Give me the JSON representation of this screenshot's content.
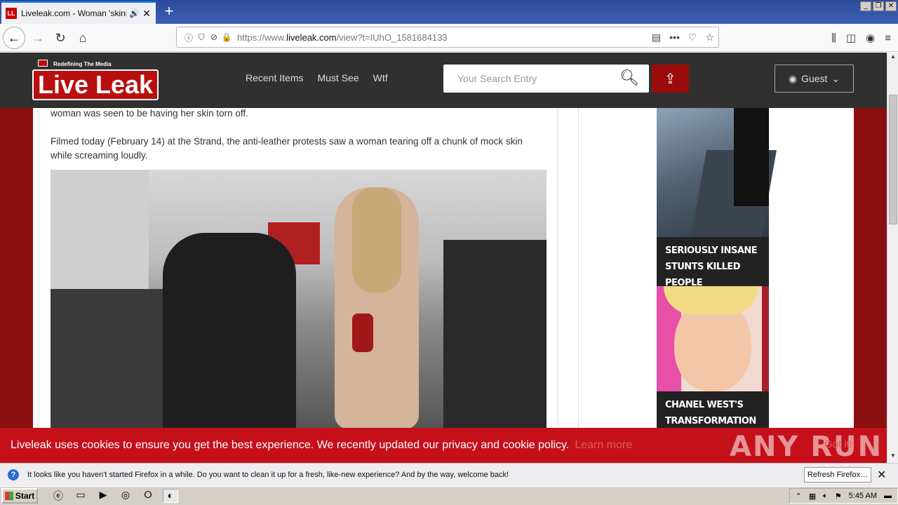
{
  "browser": {
    "tab_title": "Liveleak.com - Woman 'skinned",
    "tab_favicon": "LL",
    "url_host_prefix": "https://www.",
    "url_host": "liveleak.com",
    "url_path": "/view?t=IUhO_1581684133"
  },
  "site": {
    "logo_tagline": "Redefining The Media",
    "logo_text": "Live Leak",
    "nav": [
      "Recent Items",
      "Must See",
      "Wtf"
    ],
    "search_placeholder": "Your Search Entry",
    "user_label": "Guest"
  },
  "article": {
    "para1": "woman was seen to be having her skin torn off.",
    "para2": "Filmed today (February 14) at the Strand, the anti-leather protests saw a woman tearing off a chunk of mock skin while screaming loudly."
  },
  "sidebar": {
    "items": [
      {
        "caption": "SERIOUSLY INSANE STUNTS KILLED PEOPLE"
      },
      {
        "caption": "CHANEL WEST'S TRANSFORMATION IS"
      }
    ]
  },
  "cookie": {
    "text": "Liveleak uses cookies to ensure you get the best experience. We recently updated our privacy and cookie policy.",
    "learn_more": "Learn more",
    "got_it": "Got it!",
    "watermark": "ANY RUN"
  },
  "notification": {
    "text": "It looks like you haven't started Firefox in a while. Do you want to clean it up for a fresh, like-new experience? And by the way, welcome back!",
    "button": "Refresh Firefox…"
  },
  "taskbar": {
    "start": "Start",
    "time": "5:45 AM"
  }
}
